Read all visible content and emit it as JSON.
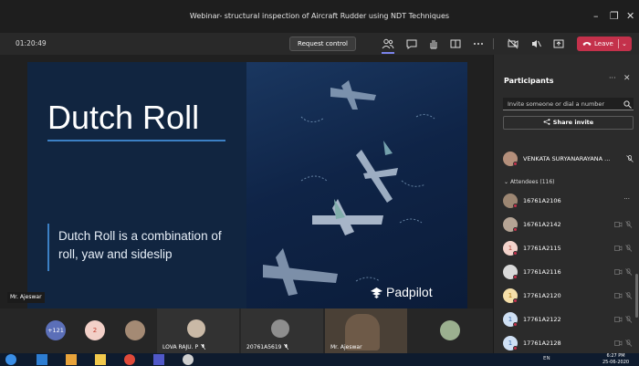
{
  "window": {
    "title": "Webinar- structural inspection of Aircraft Rudder using NDT Techniques"
  },
  "toolbar": {
    "timer": "01:20:49",
    "request_control_label": "Request control",
    "leave_label": "Leave"
  },
  "slide": {
    "title": "Dutch Roll",
    "body": "Dutch Roll is a combination of roll, yaw and sideslip",
    "brand": "Padpilot"
  },
  "spotlight": {
    "name": "Mr. Ajeswar"
  },
  "gallery": {
    "overflow_count": "+121",
    "tile_initial": "2",
    "tiles": [
      {
        "name": "LOVA RAJU. P"
      },
      {
        "name": "20761A5619"
      },
      {
        "name": "Mr. Ajeswar"
      }
    ]
  },
  "participants": {
    "title": "Participants",
    "invite_placeholder": "Invite someone or dial a number",
    "share_invite_label": "Share invite",
    "presenter": {
      "name": "VENKATA SURYANARAYANA ..."
    },
    "attendees_header": "Attendees (116)",
    "attendees": [
      {
        "name": "16761A2106",
        "initial": ""
      },
      {
        "name": "16761A2142",
        "initial": ""
      },
      {
        "name": "17761A2115",
        "initial": "1"
      },
      {
        "name": "17761A2116",
        "initial": ""
      },
      {
        "name": "17761A2120",
        "initial": "1"
      },
      {
        "name": "17761A2122",
        "initial": "1"
      },
      {
        "name": "17761A2128",
        "initial": "1"
      }
    ]
  },
  "taskbar": {
    "time": "6:27 PM",
    "date": "25-06-2020",
    "lang": "EN"
  },
  "colors": {
    "leave": "#c4314b",
    "accent": "#7b83eb",
    "slide_bg": "#10213a",
    "rule": "#3c80c4"
  }
}
